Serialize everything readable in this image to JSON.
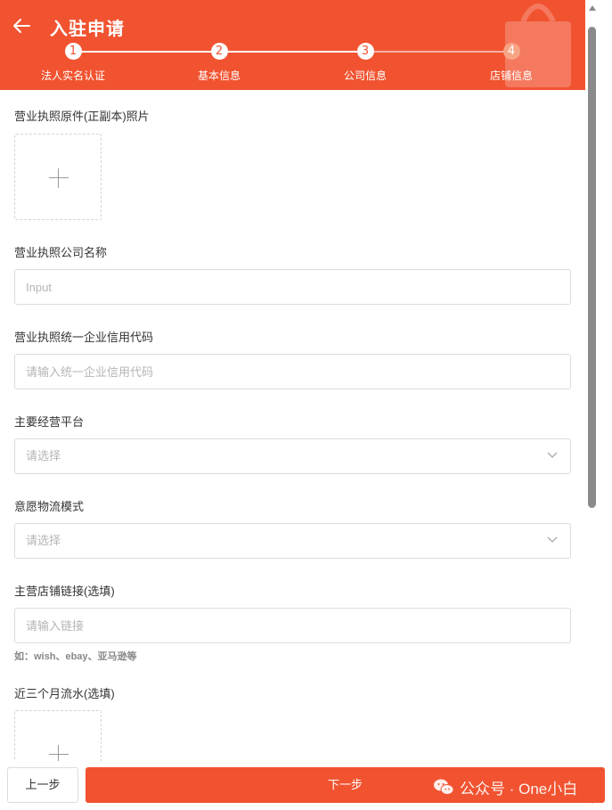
{
  "header": {
    "title": "入驻申请",
    "back_icon": "arrow-left-icon",
    "steps": [
      {
        "number": "1",
        "label": "法人实名认证"
      },
      {
        "number": "2",
        "label": "基本信息"
      },
      {
        "number": "3",
        "label": "公司信息"
      },
      {
        "number": "4",
        "label": "店铺信息"
      }
    ],
    "current_step": 4
  },
  "form": {
    "license_photo": {
      "label": "营业执照原件(正副本)照片",
      "icon": "plus-icon"
    },
    "company_name": {
      "label": "营业执照公司名称",
      "placeholder": "Input"
    },
    "credit_code": {
      "label": "营业执照统一企业信用代码",
      "placeholder": "请输入统一企业信用代码"
    },
    "platform": {
      "label": "主要经营平台",
      "placeholder": "请选择"
    },
    "logistics": {
      "label": "意愿物流模式",
      "placeholder": "请选择"
    },
    "store_link": {
      "label": "主营店铺链接(选填)",
      "placeholder": "请输入链接",
      "hint": "如：wish、ebay、亚马逊等"
    },
    "turnover": {
      "label": "近三个月流水(选填)",
      "icon": "plus-icon"
    }
  },
  "footer": {
    "prev_label": "上一步",
    "next_label": "下一步",
    "watermark": "公众号 · One小白"
  },
  "colors": {
    "brand": "#f15330",
    "border": "#dcdcdc",
    "placeholder": "#b5b5b5"
  }
}
